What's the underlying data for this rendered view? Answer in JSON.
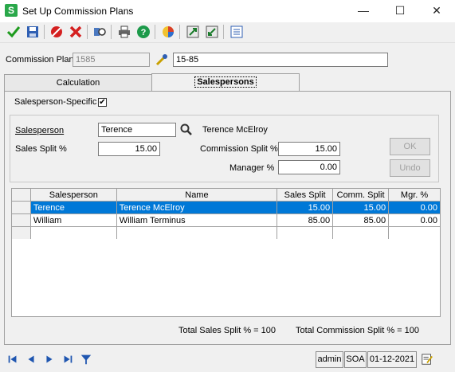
{
  "window": {
    "title": "Set Up Commission Plans",
    "minimize": "—",
    "maximize": "☐",
    "close": "✕"
  },
  "header": {
    "plan_label": "Commission Plan",
    "plan_id": "1585",
    "plan_name": "15-85"
  },
  "tabs": {
    "calculation": "Calculation",
    "salespersons": "Salespersons"
  },
  "form": {
    "specific_label": "Salesperson-Specific",
    "specific_checked": "✔",
    "salesperson_label": "Salesperson",
    "salesperson_value": "Terence",
    "salesperson_fullname": "Terence McElroy",
    "sales_split_label": "Sales Split %",
    "sales_split_value": "15.00",
    "comm_split_label": "Commission Split %",
    "comm_split_value": "15.00",
    "manager_label": "Manager %",
    "manager_value": "0.00",
    "ok_label": "OK",
    "undo_label": "Undo"
  },
  "grid": {
    "headers": {
      "salesperson": "Salesperson",
      "name": "Name",
      "sales_split": "Sales Split",
      "comm_split": "Comm. Split",
      "mgr": "Mgr. %"
    },
    "rows": [
      {
        "salesperson": "Terence",
        "name": "Terence McElroy",
        "sales_split": "15.00",
        "comm_split": "15.00",
        "mgr": "0.00"
      },
      {
        "salesperson": "William",
        "name": "William Terminus",
        "sales_split": "85.00",
        "comm_split": "85.00",
        "mgr": "0.00"
      }
    ]
  },
  "totals": {
    "sales": "Total Sales Split % = 100",
    "commission": "Total Commission Split % = 100"
  },
  "status": {
    "user": "admin",
    "company": "SOA",
    "date": "01-12-2021"
  },
  "colors": {
    "selection": "#0078d7",
    "app_icon": "#2aa84a"
  },
  "icons": [
    "check-icon",
    "save-icon",
    "cancel-icon",
    "delete-icon",
    "find-icon",
    "print-icon",
    "help-icon",
    "color-icon",
    "export-icon",
    "import-icon",
    "list-icon",
    "lookup-icon",
    "first-icon",
    "prev-icon",
    "next-icon",
    "last-icon",
    "filter-icon",
    "note-icon"
  ]
}
